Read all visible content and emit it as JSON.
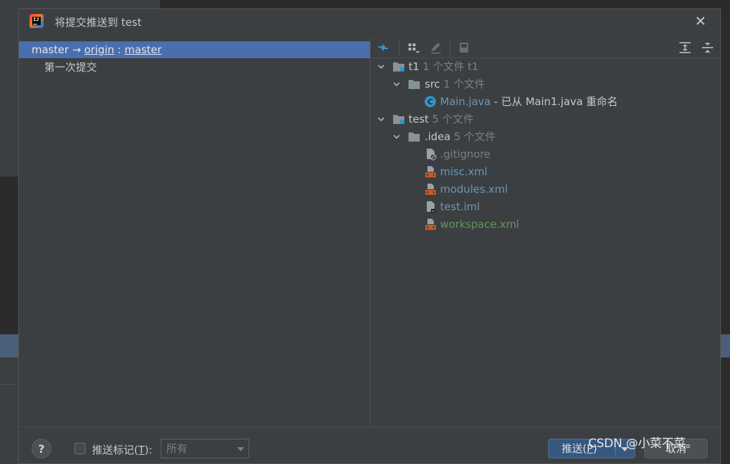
{
  "dialog": {
    "title": "将提交推送到 test",
    "close_icon": "close-icon"
  },
  "left": {
    "branch": {
      "local": "master",
      "arrow": "→",
      "remote": "origin",
      "colon": ":",
      "remote_branch": "master"
    },
    "commits": [
      "第一次提交"
    ]
  },
  "toolbar": {
    "icons": [
      "diff-icon",
      "group-by-icon",
      "edit-icon",
      "save-icon",
      "expand-all-icon",
      "collapse-all-icon"
    ]
  },
  "tree": {
    "t1": {
      "name": "t1",
      "meta": "1 个文件  t1"
    },
    "src": {
      "name": "src",
      "meta": "1 个文件"
    },
    "main_java": {
      "name": "Main.java",
      "note": " - 已从 Main1.java 重命名"
    },
    "test": {
      "name": "test",
      "meta": "5 个文件"
    },
    "idea": {
      "name": ".idea",
      "meta": "5 个文件"
    },
    "files": [
      {
        "name": ".gitignore",
        "icon": "ignore-file-icon",
        "color": "#7c7f82"
      },
      {
        "name": "misc.xml",
        "icon": "xml-file-icon",
        "color": "#6897bb"
      },
      {
        "name": "modules.xml",
        "icon": "xml-file-icon",
        "color": "#6897bb"
      },
      {
        "name": "test.iml",
        "icon": "iml-file-icon",
        "color": "#6897bb"
      },
      {
        "name": "workspace.xml",
        "icon": "xml-file-icon",
        "color": "#629755"
      }
    ]
  },
  "footer": {
    "help": "?",
    "push_tags_label_prefix": "推送标记(",
    "push_tags_mnemonic": "T",
    "push_tags_label_suffix": "):",
    "tags_select_value": "所有",
    "push_button_prefix": "推送(",
    "push_button_mnemonic": "P",
    "push_button_suffix": ")",
    "cancel_button": "取消"
  },
  "watermark": "CSDN @小菜不菜。",
  "colors": {
    "selection": "#4b6eaf",
    "dialog_bg": "#3c3f41",
    "primary_button": "#365880"
  }
}
